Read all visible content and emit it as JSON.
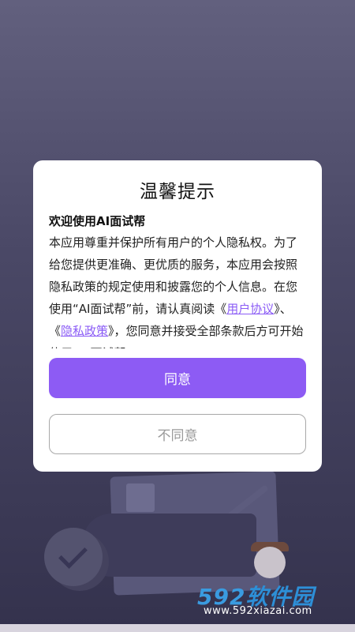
{
  "dialog": {
    "title": "温馨提示",
    "welcome": "欢迎使用AI面试帮",
    "body_before": "本应用尊重并保护所有用户的个人隐私权。为了给您提供更准确、更优质的服务，本应用会按照隐私政策的规定使用和披露您的个人信息。在您使用“AI面试帮”前，请认真阅读《",
    "link_user_agreement": "用户协议",
    "body_middle": "》、《",
    "link_privacy_policy": "隐私政策",
    "body_after": "》，您同意并接受全部条款后方可开始使用“AI面试帮”。",
    "agree_label": "同意",
    "disagree_label": "不同意"
  },
  "watermark": {
    "logo_number": "592",
    "logo_text": "软件园",
    "url": "www.592xiazai.com"
  },
  "colors": {
    "accent": "#8d5bf4",
    "link": "#8b5cf6",
    "background_top": "#62607e",
    "background_bottom": "#34324d"
  }
}
